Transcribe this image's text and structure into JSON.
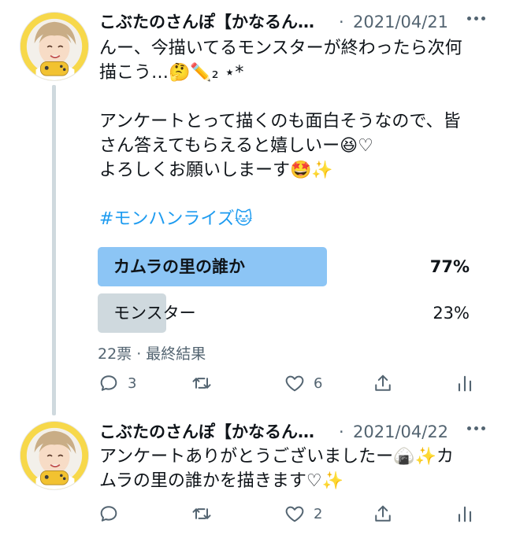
{
  "tweets": [
    {
      "author": "こぶたのさんぽ【かなるん…",
      "separator": "·",
      "date": "2021/04/21",
      "lines": [
        "んー、今描いてるモンスターが終わったら次何",
        "描こう…🤔✏️﻿₂ ⋆*",
        "",
        "アンケートとって描くのも面白そうなので、皆",
        "さん答えてもらえると嬉しいー😆♡",
        "よろしくお願いしまーす🤩✨"
      ],
      "hashtag": "#モンハンライズ🐱",
      "poll": {
        "options": [
          {
            "label": "カムラの里の誰か",
            "percent": "77%",
            "fraction": 0.77,
            "winner": true
          },
          {
            "label": "モンスター",
            "percent": "23%",
            "fraction": 0.23,
            "winner": false
          }
        ],
        "meta": "22票 · 最終結果"
      },
      "actions": {
        "reply_count": "3",
        "retweet_count": "",
        "like_count": "6"
      }
    },
    {
      "author": "こぶたのさんぽ【かなるん…",
      "separator": "·",
      "date": "2021/04/22",
      "lines": [
        "アンケートありがとうございましたー🍙✨カ",
        "ムラの里の誰かを描きます♡✨"
      ],
      "actions": {
        "reply_count": "",
        "retweet_count": "",
        "like_count": "2"
      }
    }
  ],
  "colors": {
    "poll_winner": "#8cc5f5",
    "poll_other": "#cfd9de",
    "hashtag": "#1d9bf0",
    "muted": "#536471",
    "avatar_bg": "#f7d84a"
  },
  "icons": [
    "avatar",
    "more-icon",
    "reply-icon",
    "retweet-icon",
    "like-icon",
    "share-icon",
    "analytics-icon"
  ]
}
